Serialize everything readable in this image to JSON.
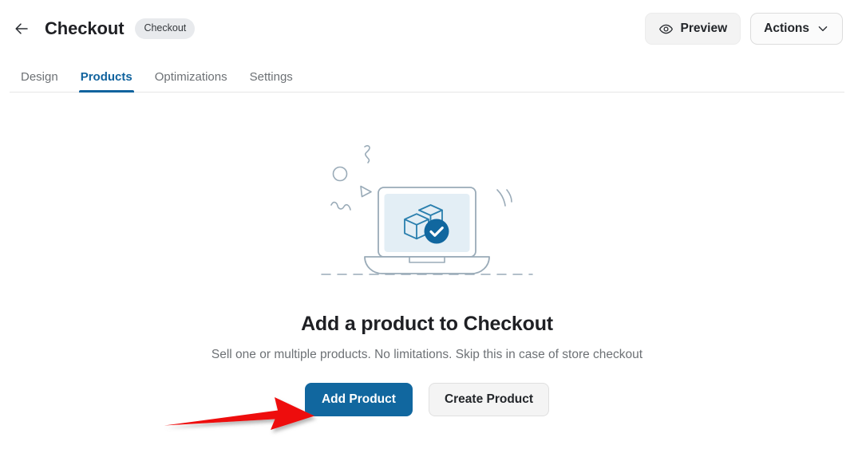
{
  "header": {
    "back_icon": "arrow-left-icon",
    "title": "Checkout",
    "badge": "Checkout",
    "preview_label": "Preview",
    "preview_icon": "eye-icon",
    "actions_label": "Actions",
    "actions_icon": "chevron-down-icon"
  },
  "tabs": [
    {
      "label": "Design",
      "active": false
    },
    {
      "label": "Products",
      "active": true
    },
    {
      "label": "Optimizations",
      "active": false
    },
    {
      "label": "Settings",
      "active": false
    }
  ],
  "empty_state": {
    "illustration": "laptop-with-product-box-check-illustration",
    "title": "Add a product to Checkout",
    "subtitle": "Sell one or multiple products. No limitations. Skip this in case of store checkout",
    "primary_button": "Add Product",
    "secondary_button": "Create Product"
  },
  "annotation": {
    "type": "red-arrow-pointing-right",
    "color": "#ee1111",
    "points_at": "Add Product"
  },
  "colors": {
    "accent": "#11679f",
    "active_tab": "#11639e",
    "badge_bg": "#e8eaed",
    "muted_text": "#6d7175",
    "illustration_line": "#9aabb8",
    "illustration_screen": "#e3eef5",
    "illustration_blue": "#2a7fae"
  }
}
